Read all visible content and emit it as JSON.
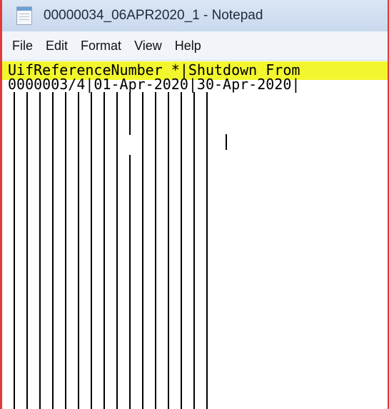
{
  "window": {
    "title": "00000034_06APR2020_1 - Notepad",
    "icon": "notepad-icon",
    "accent_border": "#e23a3a",
    "highlight_color": "#f2f62e"
  },
  "menubar": {
    "items": [
      "File",
      "Edit",
      "Format",
      "View",
      "Help"
    ]
  },
  "document": {
    "line1": "UifReferenceNumber *|Shutdown From",
    "line2": "0000003/4|01-Apr-2020|30-Apr-2020|",
    "pipe_columns": 16
  }
}
